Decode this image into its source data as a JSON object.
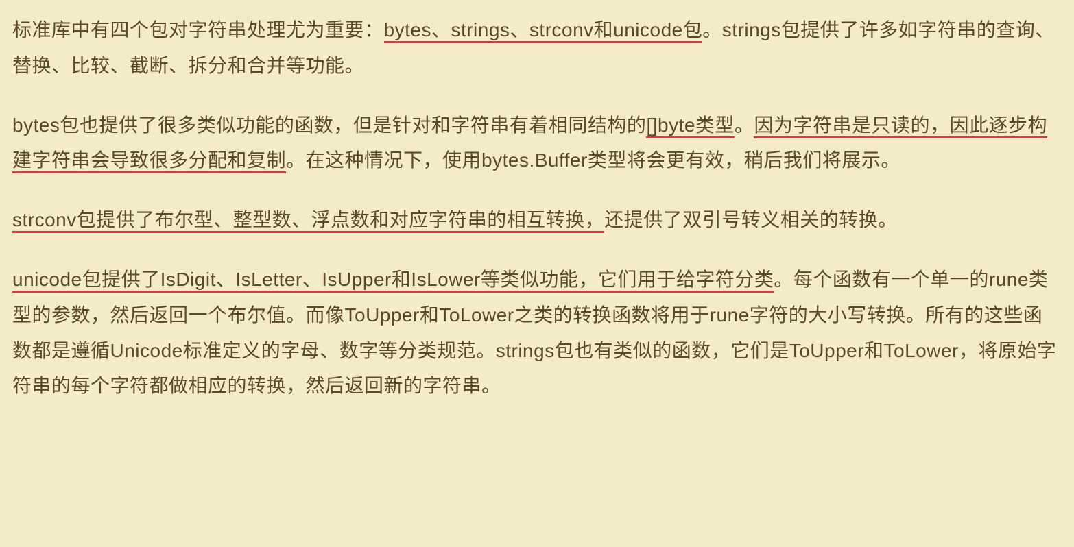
{
  "paragraphs": [
    {
      "segments": [
        {
          "text": "标准库中有四个包对字符串处理尤为重要：",
          "underlined": false
        },
        {
          "text": "bytes、strings、strconv和unicode包",
          "underlined": true
        },
        {
          "text": "。strings包提供了许多如字符串的查询、替换、比较、截断、拆分和合并等功能。",
          "underlined": false
        }
      ]
    },
    {
      "segments": [
        {
          "text": "bytes包也提供了很多类似功能的函数，但是针对和字符串有着相同结构的",
          "underlined": false
        },
        {
          "text": "[]byte类型",
          "underlined": true
        },
        {
          "text": "。",
          "underlined": false
        },
        {
          "text": "因为字符串是只读的，因此逐步构建字符串会导致很多分配和复制",
          "underlined": true
        },
        {
          "text": "。在这种情况下，使用bytes.Buffer类型将会更有效，稍后我们将展示。",
          "underlined": false
        }
      ]
    },
    {
      "segments": [
        {
          "text": "strconv包提供了布尔型、整型数、浮点数和对应字符串的相互转换，",
          "underlined": true
        },
        {
          "text": "还提供了双引号转义相关的转换。",
          "underlined": false
        }
      ]
    },
    {
      "segments": [
        {
          "text": "unicode包提供了IsDigit、IsLetter、IsUpper和IsLower等类似功能，它们用于给字符分类",
          "underlined": true
        },
        {
          "text": "。每个函数有一个单一的rune类型的参数，然后返回一个布尔值。而像ToUpper和ToLower之类的转换函数将用于rune字符的大小写转换。所有的这些函数都是遵循Unicode标准定义的字母、数字等分类规范。strings包也有类似的函数，它们是ToUpper和ToLower，将原始字符串的每个字符都做相应的转换，然后返回新的字符串。",
          "underlined": false
        }
      ]
    }
  ]
}
